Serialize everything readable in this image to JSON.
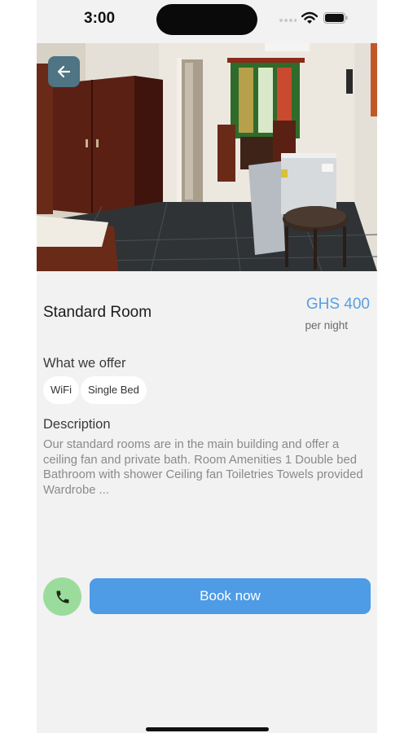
{
  "status_bar": {
    "time": "3:00"
  },
  "room": {
    "title": "Standard Room",
    "price": "GHS 400",
    "price_unit": "per night"
  },
  "offer": {
    "heading": "What we offer",
    "tags": [
      "WiFi",
      "Single Bed"
    ]
  },
  "description": {
    "heading": "Description",
    "text": "Our standard rooms are in the main building and offer a ceiling fan and private bath. Room Amenities 1 Double bed Bathroom with shower Ceiling fan Toiletries Towels provided Wardrobe ..."
  },
  "actions": {
    "book_label": "Book now"
  },
  "icons": {
    "back": "arrow-left-icon",
    "call": "phone-icon",
    "signal": "signal-icon",
    "wifi": "wifi-icon",
    "battery": "battery-icon"
  },
  "colors": {
    "accent": "#4e9be6",
    "price": "#5a9fe0",
    "call": "#9bdc9c",
    "back_button": "#4f7483",
    "background": "#f2f2f2"
  }
}
